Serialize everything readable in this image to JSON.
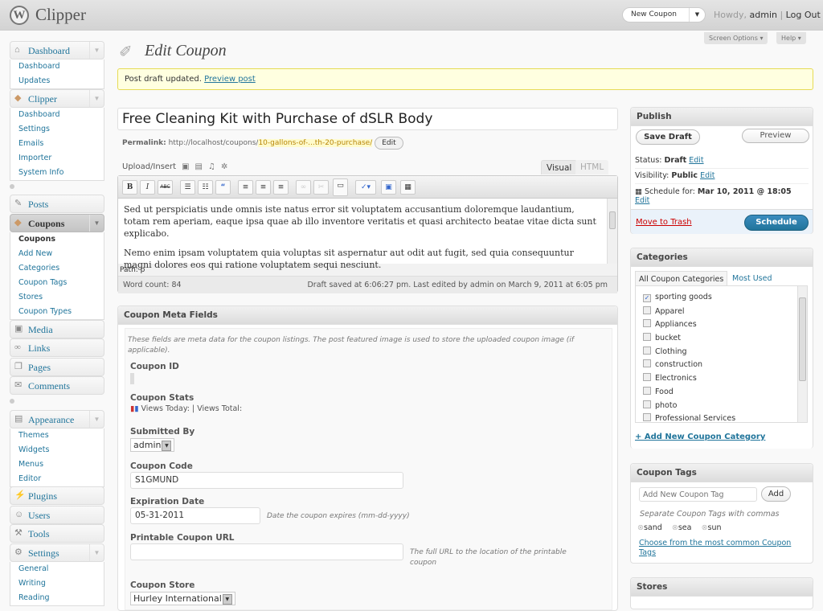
{
  "header": {
    "site": "Clipper",
    "new_button": "New Coupon",
    "howdy": "Howdy,",
    "user": "admin",
    "logout": "Log Out",
    "screen_options": "Screen Options",
    "help": "Help"
  },
  "sidebar": {
    "dashboard": {
      "label": "Dashboard",
      "items": [
        "Dashboard",
        "Updates"
      ]
    },
    "clipper": {
      "label": "Clipper",
      "items": [
        "Dashboard",
        "Settings",
        "Emails",
        "Importer",
        "System Info"
      ]
    },
    "posts": "Posts",
    "coupons": {
      "label": "Coupons",
      "items": [
        "Coupons",
        "Add New",
        "Categories",
        "Coupon Tags",
        "Stores",
        "Coupon Types"
      ]
    },
    "media": "Media",
    "links": "Links",
    "pages": "Pages",
    "comments": "Comments",
    "appearance": {
      "label": "Appearance",
      "items": [
        "Themes",
        "Widgets",
        "Menus",
        "Editor"
      ]
    },
    "plugins": "Plugins",
    "users": "Users",
    "tools": "Tools",
    "settings": {
      "label": "Settings",
      "items": [
        "General",
        "Writing",
        "Reading"
      ]
    }
  },
  "page": {
    "title": "Edit Coupon",
    "notice": "Post draft updated.",
    "notice_link": "Preview post"
  },
  "post": {
    "title": "Free Cleaning Kit with Purchase of dSLR Body",
    "permalink_label": "Permalink:",
    "permalink_base": "http://localhost/coupons/",
    "permalink_slug": "10-gallons-of-...th-20-purchase/",
    "edit": "Edit"
  },
  "editor": {
    "upload_insert": "Upload/Insert",
    "tab_visual": "Visual",
    "tab_html": "HTML",
    "paragraphs": [
      "Sed ut perspiciatis unde omnis iste natus error sit voluptatem accusantium doloremque laudantium, totam rem aperiam, eaque ipsa quae ab illo inventore veritatis et quasi architecto beatae vitae dicta sunt explicabo.",
      "Nemo enim ipsam voluptatem quia voluptas sit aspernatur aut odit aut fugit, sed quia consequuntur magni dolores eos qui ratione voluptatem sequi nesciunt."
    ],
    "path": "Path: p",
    "word_count": "Word count: 84",
    "draft_saved": "Draft saved at 6:06:27 pm. Last edited by admin on March 9, 2011 at 6:05 pm"
  },
  "meta": {
    "title": "Coupon Meta Fields",
    "description": "These fields are meta data for the coupon listings. The post featured image is used to store the uploaded coupon image (if applicable).",
    "coupon_id_label": "Coupon ID",
    "stats_label": "Coupon Stats",
    "stats": "Views Today: | Views Total:",
    "submitted_label": "Submitted By",
    "submitted_value": "admin",
    "code_label": "Coupon Code",
    "code_value": "S1GMUND",
    "exp_label": "Expiration Date",
    "exp_value": "05-31-2011",
    "exp_hint": "Date the coupon expires (mm-dd-yyyy)",
    "url_label": "Printable Coupon URL",
    "url_value": "",
    "url_hint": "The full URL to the location of the printable coupon",
    "store_label": "Coupon Store",
    "store_value": "Hurley International"
  },
  "publish": {
    "title": "Publish",
    "save_draft": "Save Draft",
    "preview": "Preview",
    "status_label": "Status:",
    "status": "Draft",
    "visibility_label": "Visibility:",
    "visibility": "Public",
    "schedule_label": "Schedule for:",
    "schedule": "Mar 10, 2011 @ 18:05",
    "edit": "Edit",
    "trash": "Move to Trash",
    "schedule_btn": "Schedule",
    "accent": "#21759b"
  },
  "categories": {
    "title": "Categories",
    "tab_all": "All Coupon Categories",
    "tab_most": "Most Used",
    "items": [
      {
        "label": "sporting goods",
        "checked": true
      },
      {
        "label": "Apparel",
        "checked": false
      },
      {
        "label": "Appliances",
        "checked": false
      },
      {
        "label": "bucket",
        "checked": false
      },
      {
        "label": "Clothing",
        "checked": false
      },
      {
        "label": "construction",
        "checked": false
      },
      {
        "label": "Electronics",
        "checked": false
      },
      {
        "label": "Food",
        "checked": false
      },
      {
        "label": "photo",
        "checked": false
      },
      {
        "label": "Professional Services",
        "checked": false
      }
    ],
    "add_new": "+ Add New Coupon Category"
  },
  "tags": {
    "title": "Coupon Tags",
    "placeholder": "Add New Coupon Tag",
    "add": "Add",
    "hint": "Separate Coupon Tags with commas",
    "items": [
      "sand",
      "sea",
      "sun"
    ],
    "choose": "Choose from the most common Coupon Tags"
  },
  "stores": {
    "title": "Stores"
  }
}
